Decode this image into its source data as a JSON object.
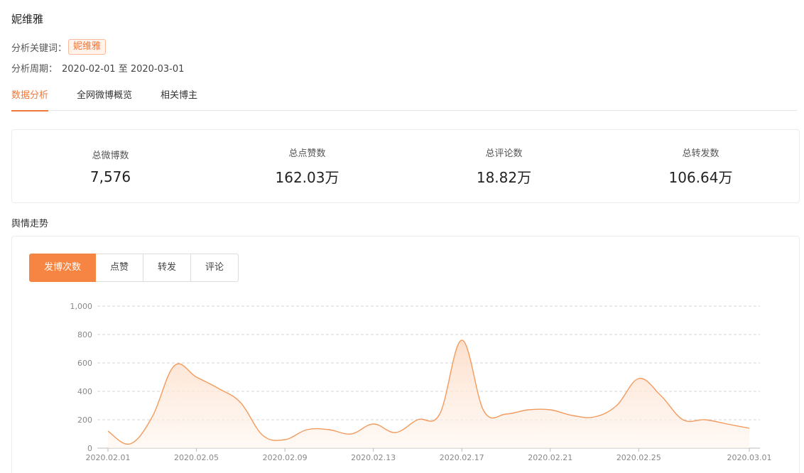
{
  "header": {
    "title": "妮维雅",
    "keyword_label": "分析关键词：",
    "keyword": "妮维雅",
    "period_label": "分析周期：",
    "period_value": "2020-02-01 至 2020-03-01"
  },
  "tabs": [
    {
      "label": "数据分析",
      "active": true
    },
    {
      "label": "全网微博概览",
      "active": false
    },
    {
      "label": "相关博主",
      "active": false
    }
  ],
  "stats": [
    {
      "label": "总微博数",
      "value": "7,576"
    },
    {
      "label": "总点赞数",
      "value": "162.03万"
    },
    {
      "label": "总评论数",
      "value": "18.82万"
    },
    {
      "label": "总转发数",
      "value": "106.64万"
    }
  ],
  "trend": {
    "section_title": "舆情走势",
    "metric_tabs": [
      {
        "label": "发博次数",
        "active": true
      },
      {
        "label": "点赞",
        "active": false
      },
      {
        "label": "转发",
        "active": false
      },
      {
        "label": "评论",
        "active": false
      }
    ]
  },
  "colors": {
    "accent": "#f68543",
    "line": "#f39a5c",
    "fill": "#fde9dc"
  },
  "chart_data": {
    "type": "area",
    "x": [
      "2020.02.01",
      "2020.02.02",
      "2020.02.03",
      "2020.02.04",
      "2020.02.05",
      "2020.02.06",
      "2020.02.07",
      "2020.02.08",
      "2020.02.09",
      "2020.02.10",
      "2020.02.11",
      "2020.02.12",
      "2020.02.13",
      "2020.02.14",
      "2020.02.15",
      "2020.02.16",
      "2020.02.17",
      "2020.02.18",
      "2020.02.19",
      "2020.02.20",
      "2020.02.21",
      "2020.02.22",
      "2020.02.23",
      "2020.02.24",
      "2020.02.25",
      "2020.02.26",
      "2020.02.27",
      "2020.02.28",
      "2020.02.29",
      "2020.03.01"
    ],
    "values": [
      120,
      30,
      220,
      580,
      500,
      420,
      320,
      90,
      60,
      130,
      130,
      100,
      170,
      110,
      200,
      240,
      760,
      260,
      240,
      270,
      270,
      230,
      220,
      300,
      490,
      370,
      200,
      200,
      170,
      140
    ],
    "x_tick_labels": [
      "2020.02.01",
      "2020.02.05",
      "2020.02.09",
      "2020.02.13",
      "2020.02.17",
      "2020.02.21",
      "2020.02.25",
      "2020.03.01"
    ],
    "y_ticks": [
      "0",
      "200",
      "400",
      "600",
      "800",
      "1,000"
    ],
    "ylim": [
      0,
      1000
    ],
    "grid": true,
    "legend": "none"
  }
}
